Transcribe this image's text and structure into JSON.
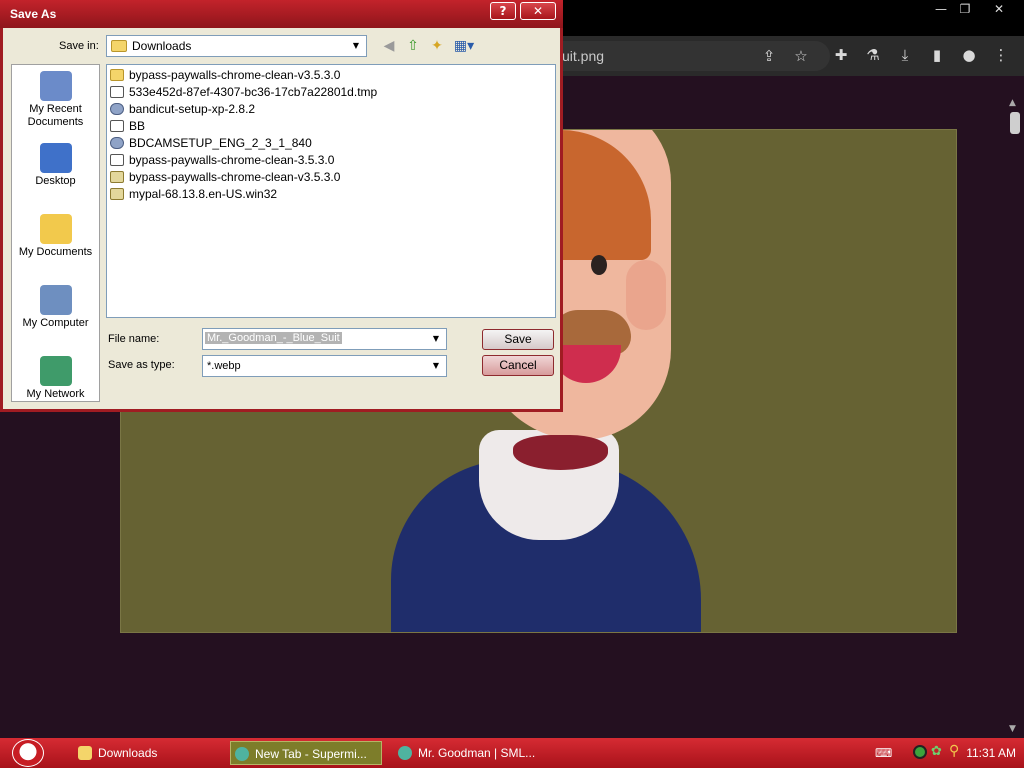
{
  "browser": {
    "url_fragment": "uit.png",
    "window_controls": [
      "—",
      "❐",
      "✕"
    ],
    "toolbar_icons": [
      "share-icon",
      "star-icon",
      "extensions-icon",
      "labs-icon",
      "download-icon",
      "sidepanel-icon",
      "profile-icon",
      "menu-icon"
    ]
  },
  "dialog": {
    "title": "Save As",
    "help_glyph": "?",
    "close_glyph": "✕",
    "save_in_label": "Save in:",
    "save_in_value": "Downloads",
    "places": [
      {
        "label": "My Recent Documents",
        "icon": "recent-documents-icon",
        "color": "#6b8bc9"
      },
      {
        "label": "Desktop",
        "icon": "desktop-icon",
        "color": "#3f71c9"
      },
      {
        "label": "My Documents",
        "icon": "my-documents-icon",
        "color": "#f2c94c"
      },
      {
        "label": "My Computer",
        "icon": "my-computer-icon",
        "color": "#6e8fc0"
      },
      {
        "label": "My Network",
        "icon": "my-network-icon",
        "color": "#3f9b6a"
      }
    ],
    "files": [
      {
        "name": "bypass-paywalls-chrome-clean-v3.5.3.0",
        "kind": "folder"
      },
      {
        "name": "533e452d-87ef-4307-bc36-17cb7a22801d.tmp",
        "kind": "doc"
      },
      {
        "name": "bandicut-setup-xp-2.8.2",
        "kind": "exe"
      },
      {
        "name": "BB",
        "kind": "doc"
      },
      {
        "name": "BDCAMSETUP_ENG_2_3_1_840",
        "kind": "exe"
      },
      {
        "name": "bypass-paywalls-chrome-clean-3.5.3.0",
        "kind": "doc"
      },
      {
        "name": "bypass-paywalls-chrome-clean-v3.5.3.0",
        "kind": "zip"
      },
      {
        "name": "mypal-68.13.8.en-US.win32",
        "kind": "zip"
      }
    ],
    "file_name_label": "File name:",
    "file_name_value": "Mr._Goodman_-_Blue_Suit",
    "save_as_type_label": "Save as type:",
    "save_as_type_value": "*.webp",
    "save_button": "Save",
    "cancel_button": "Cancel"
  },
  "taskbar": {
    "tasks": [
      {
        "label": "Downloads",
        "icon": "folder-icon",
        "active": false
      },
      {
        "label": "New Tab - Supermi...",
        "icon": "browser-icon",
        "active": true
      },
      {
        "label": "Mr. Goodman | SML...",
        "icon": "browser-icon",
        "active": false
      }
    ],
    "clock": "11:31 AM"
  },
  "colors": {
    "dialog_frame": "#a01c22",
    "taskbar": "#c41f27",
    "image_background": "#666233"
  }
}
